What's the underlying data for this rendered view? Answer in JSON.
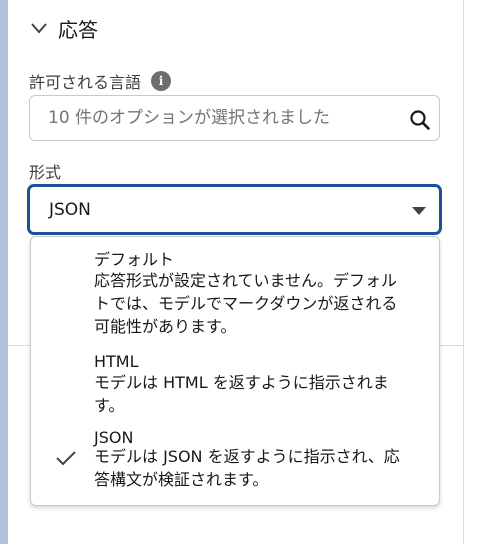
{
  "section": {
    "title": "応答",
    "chevron_icon": "chevron-down-icon"
  },
  "languages": {
    "label": "許可される言語",
    "info_icon": "info-icon",
    "info_glyph": "i",
    "placeholder": "10 件のオプションが選択されました",
    "search_icon": "search-icon"
  },
  "format": {
    "label": "形式",
    "selected_value": "JSON",
    "caret_icon": "caret-down-icon",
    "options": [
      {
        "title": "デフォルト",
        "desc_lines": [
          "応答形式が設定されていません。デフォル",
          "トでは、モデルでマークダウンが返される",
          "可能性があります。"
        ],
        "selected": false
      },
      {
        "title": "HTML",
        "desc_lines": [
          "モデルは HTML を返すように指示されま",
          "す。"
        ],
        "selected": false
      },
      {
        "title": "JSON",
        "desc_lines": [
          "モデルは JSON を返すように指示され、応",
          "答構文が検証されます。"
        ],
        "selected": true
      }
    ]
  },
  "colors": {
    "focus_border": "#1b5297",
    "left_accent": "#b0c4df",
    "text": "#181818",
    "placeholder": "#747474"
  }
}
